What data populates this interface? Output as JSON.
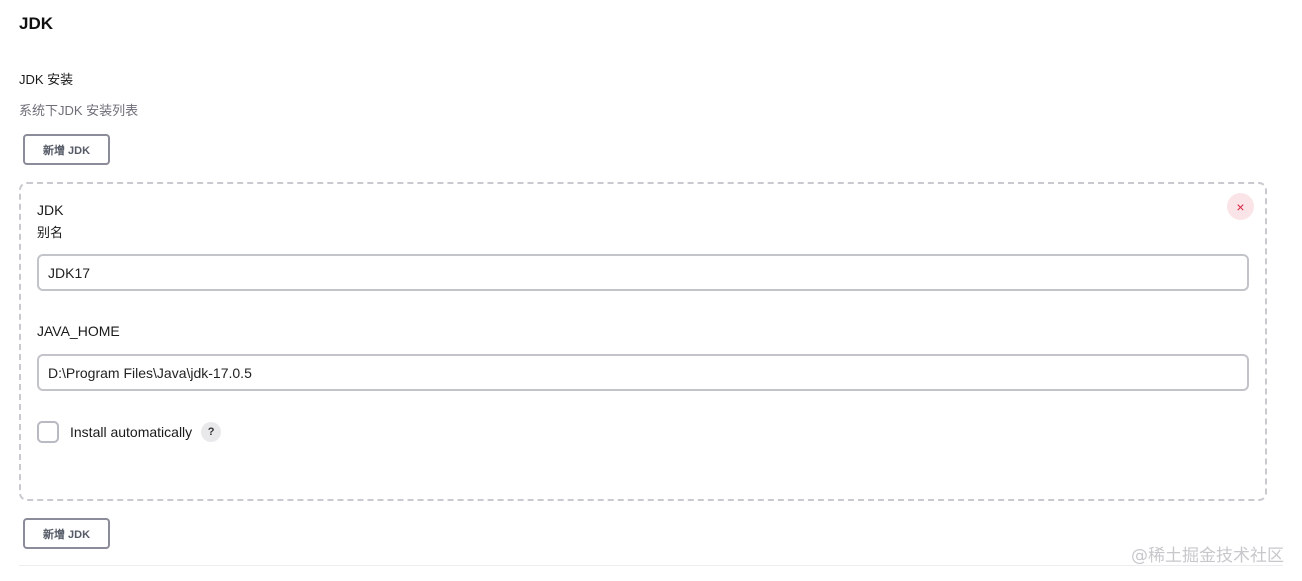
{
  "section": {
    "title": "JDK"
  },
  "installations": {
    "label": "JDK 安装",
    "description": "系统下JDK 安装列表",
    "add_button_label": "新增 JDK"
  },
  "jdk_item": {
    "kind": "JDK",
    "name_label": "别名",
    "name_value": "JDK17",
    "home_label": "JAVA_HOME",
    "home_value": "D:\\Program Files\\Java\\jdk-17.0.5",
    "delete_glyph": "×",
    "install_automatically": {
      "label": "Install automatically",
      "checked": false,
      "help_glyph": "?"
    }
  },
  "watermark": "@稀土掘金技术社区",
  "colors": {
    "delete_bg": "#fbe4e8",
    "delete_fg": "#d4233f",
    "button_border": "#8a8d99",
    "dashed_border": "#c9c9cf"
  }
}
